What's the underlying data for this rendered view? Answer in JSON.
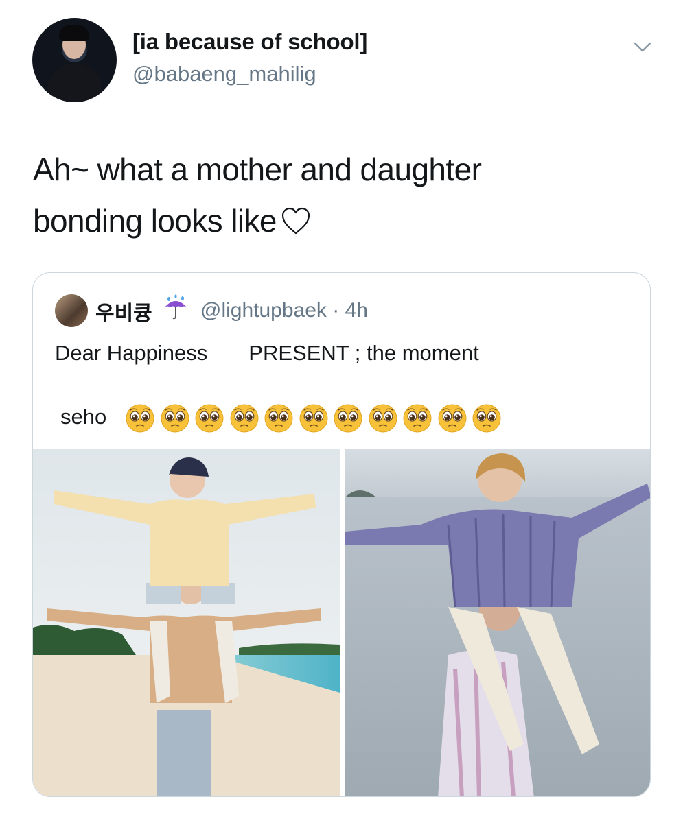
{
  "tweet": {
    "author": {
      "display_name": "[ia because of school]",
      "handle": "@babaeng_mahilig",
      "avatar_icon": "profile-photo"
    },
    "menu_icon": "chevron-down-icon",
    "text_line1": "Ah~ what a mother and daughter",
    "text_line2": "bonding looks like",
    "text_emoji": "white-heart"
  },
  "quoted_tweet": {
    "author_name": "우비큥",
    "author_emoji": "umbrella-with-rain-drops",
    "handle_time": "@lightupbaek · 4h",
    "line1_part1": "Dear Happiness",
    "line1_part2": "PRESENT ; the moment",
    "line2_text": "seho",
    "emoji_name": "pleading-face",
    "emoji_count": 11,
    "media": [
      {
        "name": "beach-photo-left",
        "description_icon": "photo"
      },
      {
        "name": "beach-photo-right",
        "description_icon": "photo"
      }
    ]
  },
  "colors": {
    "text_primary": "#14171a",
    "text_secondary": "#657786",
    "border": "#ccd6dd"
  }
}
